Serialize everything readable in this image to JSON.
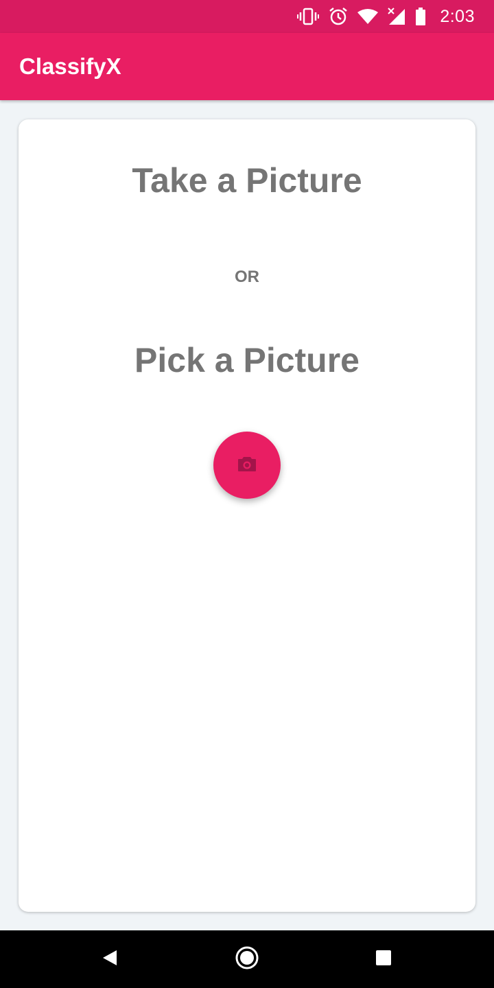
{
  "status_bar": {
    "time": "2:03",
    "icons": [
      "vibrate-icon",
      "alarm-icon",
      "wifi-icon",
      "signal-icon",
      "battery-icon"
    ]
  },
  "app_bar": {
    "title": "ClassifyX"
  },
  "card": {
    "take_title": "Take a Picture",
    "or_label": "OR",
    "pick_title": "Pick a Picture",
    "camera_button_icon": "camera-icon"
  },
  "nav_bar": {
    "icons": [
      "back-icon",
      "home-icon",
      "recents-icon"
    ]
  },
  "colors": {
    "status_bar": "#d81b60",
    "primary": "#e91e63",
    "heading_text": "#757575",
    "background": "#f0f4f7",
    "camera_icon": "#a3144a"
  }
}
